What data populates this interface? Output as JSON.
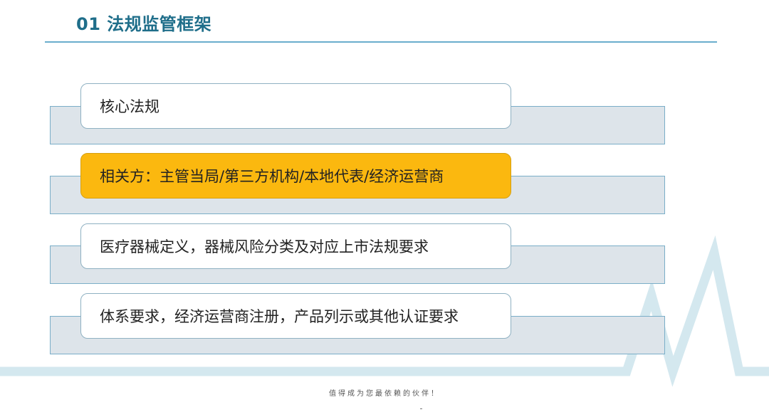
{
  "slide": {
    "title": "01 法规监管框架",
    "items": [
      {
        "label": "核心法规",
        "highlighted": false
      },
      {
        "label": "相关方：主管当局/第三方机构/本地代表/经济运营商",
        "highlighted": true
      },
      {
        "label": "医疗器械定义，器械风险分类及对应上市法规要求",
        "highlighted": false
      },
      {
        "label": "体系要求，经济运营商注册，产品列示或其他认证要求",
        "highlighted": false
      }
    ],
    "footer": "值得成为您最依赖的伙伴！"
  },
  "colors": {
    "title": "#1f6e8a",
    "rule": "#6aaecd",
    "bar_fill": "#dde4ea",
    "bar_border": "#7aaec8",
    "highlight": "#fbb80f",
    "ecg": "#d4e8ef"
  }
}
